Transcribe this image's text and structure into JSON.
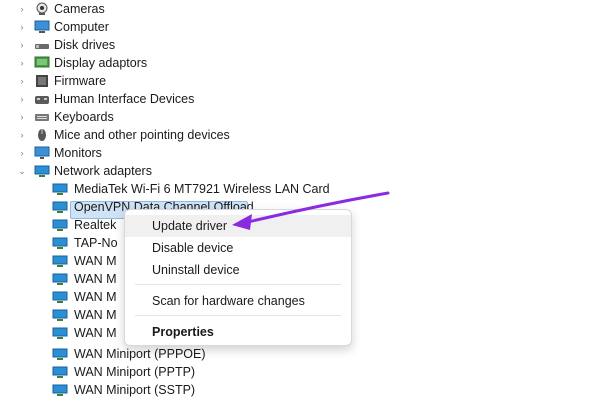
{
  "tree": {
    "categories": [
      {
        "label": "Cameras",
        "icon": "camera-icon",
        "expanded": false
      },
      {
        "label": "Computer",
        "icon": "computer-icon",
        "expanded": false
      },
      {
        "label": "Disk drives",
        "icon": "disk-drive-icon",
        "expanded": false
      },
      {
        "label": "Display adaptors",
        "icon": "display-adapter-icon",
        "expanded": false
      },
      {
        "label": "Firmware",
        "icon": "firmware-icon",
        "expanded": false
      },
      {
        "label": "Human Interface Devices",
        "icon": "hid-icon",
        "expanded": false
      },
      {
        "label": "Keyboards",
        "icon": "keyboard-icon",
        "expanded": false
      },
      {
        "label": "Mice and other pointing devices",
        "icon": "mouse-icon",
        "expanded": false
      },
      {
        "label": "Monitors",
        "icon": "monitor-icon",
        "expanded": false
      },
      {
        "label": "Network adapters",
        "icon": "network-adapter-icon",
        "expanded": true
      }
    ],
    "network_children": [
      {
        "label": "MediaTek Wi-Fi 6 MT7921 Wireless LAN Card",
        "icon": "network-adapter-icon"
      },
      {
        "label": "OpenVPN Data Channel Offload",
        "icon": "network-adapter-icon",
        "selected": true
      },
      {
        "label": "Realtek",
        "icon": "network-adapter-icon"
      },
      {
        "label": "TAP-No",
        "icon": "network-adapter-icon"
      },
      {
        "label": "WAN M",
        "icon": "network-adapter-icon"
      },
      {
        "label": "WAN M",
        "icon": "network-adapter-icon"
      },
      {
        "label": "WAN M",
        "icon": "network-adapter-icon"
      },
      {
        "label": "WAN M",
        "icon": "network-adapter-icon"
      },
      {
        "label": "WAN M",
        "icon": "network-adapter-icon"
      },
      {
        "label": "WAN Miniport (PPPOE)",
        "icon": "network-adapter-icon"
      },
      {
        "label": "WAN Miniport (PPTP)",
        "icon": "network-adapter-icon"
      },
      {
        "label": "WAN Miniport (SSTP)",
        "icon": "network-adapter-icon"
      }
    ]
  },
  "context_menu": {
    "update_driver": "Update driver",
    "disable_device": "Disable device",
    "uninstall_device": "Uninstall device",
    "scan_hardware": "Scan for hardware changes",
    "properties": "Properties"
  },
  "colors": {
    "selection": "#cfe3f7",
    "annotation_arrow": "#8a2be2",
    "network_icon": "#2b8fd6"
  }
}
